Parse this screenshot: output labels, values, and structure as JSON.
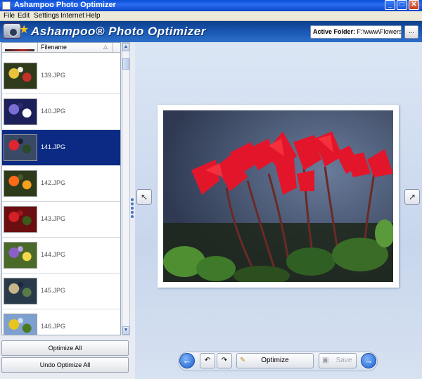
{
  "window": {
    "title": "Ashampoo Photo Optimizer",
    "controls": {
      "minimize": "_",
      "maximize": "□",
      "close": "✕"
    }
  },
  "menu": [
    "File",
    "Edit",
    "Settings",
    "Internet",
    "Help"
  ],
  "header": {
    "brand": "Ashampoo® Photo Optimizer",
    "active_folder_label": "Active Folder:",
    "active_folder_path": "F:\\www\\Flowers\\",
    "browse_label": "..."
  },
  "file_list": {
    "column_header": "Filename",
    "selected_index": 2,
    "items": [
      {
        "name": "139.JPG",
        "thumb_colors": [
          "#2f3a1a",
          "#e8c23a",
          "#c4302a",
          "#f1efe5"
        ]
      },
      {
        "name": "140.JPG",
        "thumb_colors": [
          "#1b1f5a",
          "#7b6fd6",
          "#ffffff",
          "#2e2a6d"
        ]
      },
      {
        "name": "141.JPG",
        "thumb_colors": [
          "#3a4a66",
          "#e0252f",
          "#2a4a2a",
          "#1a2230"
        ]
      },
      {
        "name": "142.JPG",
        "thumb_colors": [
          "#2d3b1b",
          "#ff6a1a",
          "#f5a01e",
          "#4a5a2a"
        ]
      },
      {
        "name": "143.JPG",
        "thumb_colors": [
          "#6b0e12",
          "#d42026",
          "#3a5a1a",
          "#a3151b"
        ]
      },
      {
        "name": "144.JPG",
        "thumb_colors": [
          "#4a6a2a",
          "#8c5fc8",
          "#f3d84a",
          "#b7a0e0"
        ]
      },
      {
        "name": "145.JPG",
        "thumb_colors": [
          "#283a4a",
          "#c8b58a",
          "#5a7a4a",
          "#1a2a3a"
        ]
      },
      {
        "name": "146.JPG",
        "thumb_colors": [
          "#7ea0d0",
          "#e8c51e",
          "#4a7a1e",
          "#cfdcef"
        ]
      }
    ]
  },
  "left_buttons": {
    "optimize_all": "Optimize All",
    "undo_optimize_all": "Undo Optimize All"
  },
  "toolbar": {
    "optimize": "Optimize",
    "save": "Save"
  }
}
